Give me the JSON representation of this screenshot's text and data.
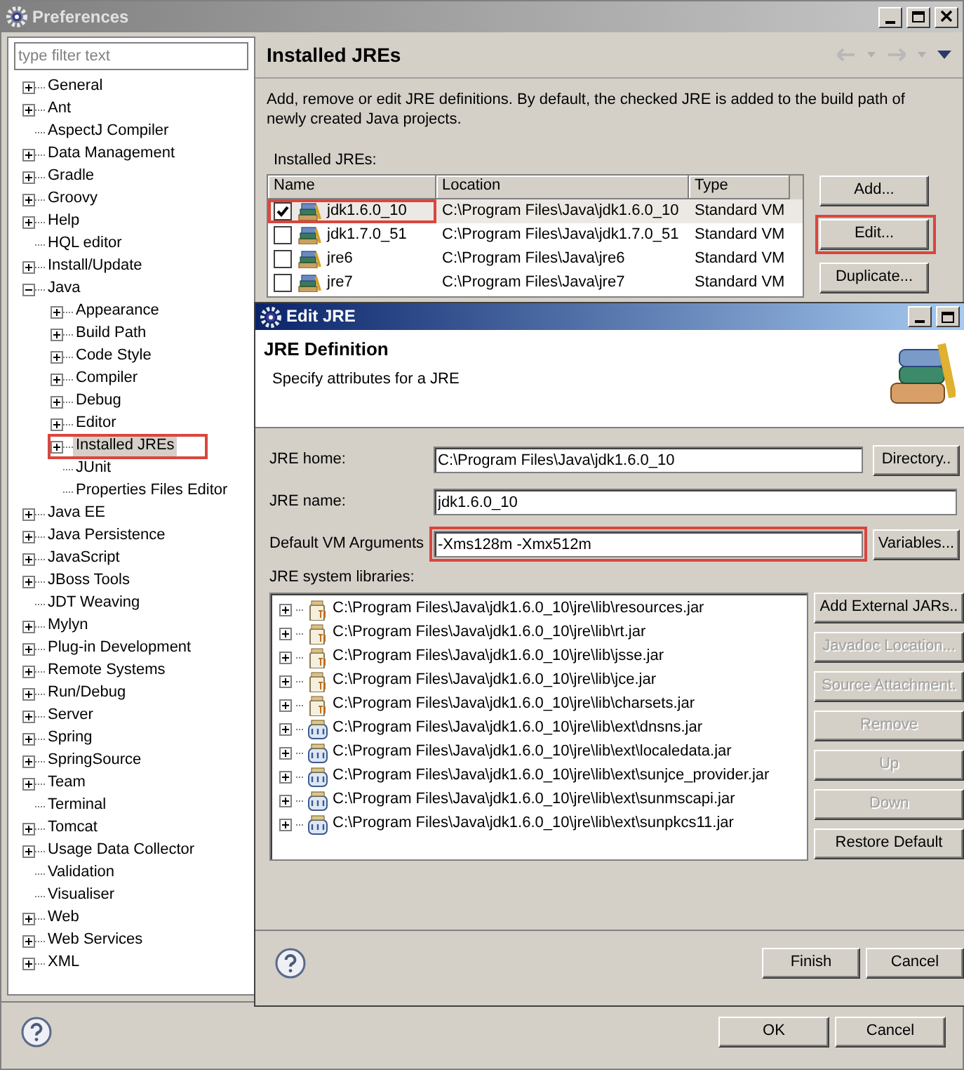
{
  "preferences": {
    "title": "Preferences",
    "filter": {
      "placeholder": "type filter text"
    },
    "tree": [
      {
        "label": "General",
        "expandable": true,
        "expanded": false,
        "selected": false,
        "highlighted": false
      },
      {
        "label": "Ant",
        "expandable": true,
        "expanded": false,
        "selected": false,
        "highlighted": false
      },
      {
        "label": "AspectJ Compiler",
        "expandable": false,
        "expanded": false,
        "selected": false,
        "highlighted": false
      },
      {
        "label": "Data Management",
        "expandable": true,
        "expanded": false,
        "selected": false,
        "highlighted": false
      },
      {
        "label": "Gradle",
        "expandable": true,
        "expanded": false,
        "selected": false,
        "highlighted": false
      },
      {
        "label": "Groovy",
        "expandable": true,
        "expanded": false,
        "selected": false,
        "highlighted": false
      },
      {
        "label": "Help",
        "expandable": true,
        "expanded": false,
        "selected": false,
        "highlighted": false
      },
      {
        "label": "HQL editor",
        "expandable": false,
        "expanded": false,
        "selected": false,
        "highlighted": false
      },
      {
        "label": "Install/Update",
        "expandable": true,
        "expanded": false,
        "selected": false,
        "highlighted": false
      },
      {
        "label": "Java",
        "expandable": true,
        "expanded": true,
        "selected": false,
        "highlighted": false,
        "children": [
          {
            "label": "Appearance",
            "expandable": true,
            "expanded": false,
            "selected": false,
            "highlighted": false
          },
          {
            "label": "Build Path",
            "expandable": true,
            "expanded": false,
            "selected": false,
            "highlighted": false
          },
          {
            "label": "Code Style",
            "expandable": true,
            "expanded": false,
            "selected": false,
            "highlighted": false
          },
          {
            "label": "Compiler",
            "expandable": true,
            "expanded": false,
            "selected": false,
            "highlighted": false
          },
          {
            "label": "Debug",
            "expandable": true,
            "expanded": false,
            "selected": false,
            "highlighted": false
          },
          {
            "label": "Editor",
            "expandable": true,
            "expanded": false,
            "selected": false,
            "highlighted": false
          },
          {
            "label": "Installed JREs",
            "expandable": true,
            "expanded": false,
            "selected": true,
            "highlighted": true
          },
          {
            "label": "JUnit",
            "expandable": false,
            "expanded": false,
            "selected": false,
            "highlighted": false
          },
          {
            "label": "Properties Files Editor",
            "expandable": false,
            "expanded": false,
            "selected": false,
            "highlighted": false
          }
        ]
      },
      {
        "label": "Java EE",
        "expandable": true,
        "expanded": false,
        "selected": false,
        "highlighted": false
      },
      {
        "label": "Java Persistence",
        "expandable": true,
        "expanded": false,
        "selected": false,
        "highlighted": false
      },
      {
        "label": "JavaScript",
        "expandable": true,
        "expanded": false,
        "selected": false,
        "highlighted": false
      },
      {
        "label": "JBoss Tools",
        "expandable": true,
        "expanded": false,
        "selected": false,
        "highlighted": false
      },
      {
        "label": "JDT Weaving",
        "expandable": false,
        "expanded": false,
        "selected": false,
        "highlighted": false
      },
      {
        "label": "Mylyn",
        "expandable": true,
        "expanded": false,
        "selected": false,
        "highlighted": false
      },
      {
        "label": "Plug-in Development",
        "expandable": true,
        "expanded": false,
        "selected": false,
        "highlighted": false
      },
      {
        "label": "Remote Systems",
        "expandable": true,
        "expanded": false,
        "selected": false,
        "highlighted": false
      },
      {
        "label": "Run/Debug",
        "expandable": true,
        "expanded": false,
        "selected": false,
        "highlighted": false
      },
      {
        "label": "Server",
        "expandable": true,
        "expanded": false,
        "selected": false,
        "highlighted": false
      },
      {
        "label": "Spring",
        "expandable": true,
        "expanded": false,
        "selected": false,
        "highlighted": false
      },
      {
        "label": "SpringSource",
        "expandable": true,
        "expanded": false,
        "selected": false,
        "highlighted": false
      },
      {
        "label": "Team",
        "expandable": true,
        "expanded": false,
        "selected": false,
        "highlighted": false
      },
      {
        "label": "Terminal",
        "expandable": false,
        "expanded": false,
        "selected": false,
        "highlighted": false
      },
      {
        "label": "Tomcat",
        "expandable": true,
        "expanded": false,
        "selected": false,
        "highlighted": false
      },
      {
        "label": "Usage Data Collector",
        "expandable": true,
        "expanded": false,
        "selected": false,
        "highlighted": false
      },
      {
        "label": "Validation",
        "expandable": false,
        "expanded": false,
        "selected": false,
        "highlighted": false
      },
      {
        "label": "Visualiser",
        "expandable": false,
        "expanded": false,
        "selected": false,
        "highlighted": false
      },
      {
        "label": "Web",
        "expandable": true,
        "expanded": false,
        "selected": false,
        "highlighted": false
      },
      {
        "label": "Web Services",
        "expandable": true,
        "expanded": false,
        "selected": false,
        "highlighted": false
      },
      {
        "label": "XML",
        "expandable": true,
        "expanded": false,
        "selected": false,
        "highlighted": false
      }
    ],
    "page": {
      "title": "Installed JREs",
      "description": "Add, remove or edit JRE definitions. By default, the checked JRE is added to the build path of newly created Java projects.",
      "table_label": "Installed JREs:",
      "columns": [
        "Name",
        "Location",
        "Type"
      ],
      "rows": [
        {
          "name": "jdk1.6.0_10",
          "location": "C:\\Program Files\\Java\\jdk1.6.0_10",
          "type": "Standard VM",
          "checked": true,
          "selected": true,
          "highlighted": true
        },
        {
          "name": "jdk1.7.0_51",
          "location": "C:\\Program Files\\Java\\jdk1.7.0_51",
          "type": "Standard VM",
          "checked": false,
          "selected": false,
          "highlighted": false
        },
        {
          "name": "jre6",
          "location": "C:\\Program Files\\Java\\jre6",
          "type": "Standard VM",
          "checked": false,
          "selected": false,
          "highlighted": false
        },
        {
          "name": "jre7",
          "location": "C:\\Program Files\\Java\\jre7",
          "type": "Standard VM",
          "checked": false,
          "selected": false,
          "highlighted": false
        }
      ],
      "buttons": [
        {
          "label": "Add...",
          "highlighted": false
        },
        {
          "label": "Edit...",
          "highlighted": true
        },
        {
          "label": "Duplicate...",
          "highlighted": false
        }
      ]
    },
    "buttons": [
      "OK",
      "Cancel"
    ]
  },
  "dialog": {
    "title": "Edit JRE",
    "heading": "JRE Definition",
    "subheading": "Specify attributes for a JRE",
    "fields": [
      {
        "label": "JRE home:",
        "value": "C:\\Program Files\\Java\\jdk1.6.0_10",
        "button": "Directory..",
        "highlighted": false
      },
      {
        "label": "JRE name:",
        "value": "jdk1.6.0_10",
        "highlighted": false
      },
      {
        "label": "Default VM Arguments",
        "value": "-Xms128m -Xmx512m",
        "button": "Variables...",
        "highlighted": true
      }
    ],
    "libraries_label": "JRE system libraries:",
    "libraries": [
      {
        "path": "C:\\Program Files\\Java\\jdk1.6.0_10\\jre\\lib\\resources.jar",
        "kind": "jar"
      },
      {
        "path": "C:\\Program Files\\Java\\jdk1.6.0_10\\jre\\lib\\rt.jar",
        "kind": "jar"
      },
      {
        "path": "C:\\Program Files\\Java\\jdk1.6.0_10\\jre\\lib\\jsse.jar",
        "kind": "jar"
      },
      {
        "path": "C:\\Program Files\\Java\\jdk1.6.0_10\\jre\\lib\\jce.jar",
        "kind": "jar"
      },
      {
        "path": "C:\\Program Files\\Java\\jdk1.6.0_10\\jre\\lib\\charsets.jar",
        "kind": "jar"
      },
      {
        "path": "C:\\Program Files\\Java\\jdk1.6.0_10\\jre\\lib\\ext\\dnsns.jar",
        "kind": "ext"
      },
      {
        "path": "C:\\Program Files\\Java\\jdk1.6.0_10\\jre\\lib\\ext\\localedata.jar",
        "kind": "ext"
      },
      {
        "path": "C:\\Program Files\\Java\\jdk1.6.0_10\\jre\\lib\\ext\\sunjce_provider.jar",
        "kind": "ext"
      },
      {
        "path": "C:\\Program Files\\Java\\jdk1.6.0_10\\jre\\lib\\ext\\sunmscapi.jar",
        "kind": "ext"
      },
      {
        "path": "C:\\Program Files\\Java\\jdk1.6.0_10\\jre\\lib\\ext\\sunpkcs11.jar",
        "kind": "ext"
      }
    ],
    "library_buttons": [
      {
        "label": "Add External JARs..",
        "disabled": false
      },
      {
        "label": "Javadoc Location...",
        "disabled": true
      },
      {
        "label": "Source Attachment.",
        "disabled": true
      },
      {
        "label": "Remove",
        "disabled": true
      },
      {
        "label": "Up",
        "disabled": true
      },
      {
        "label": "Down",
        "disabled": true
      },
      {
        "label": "Restore Default",
        "disabled": false
      }
    ],
    "buttons": [
      "Finish",
      "Cancel"
    ]
  }
}
